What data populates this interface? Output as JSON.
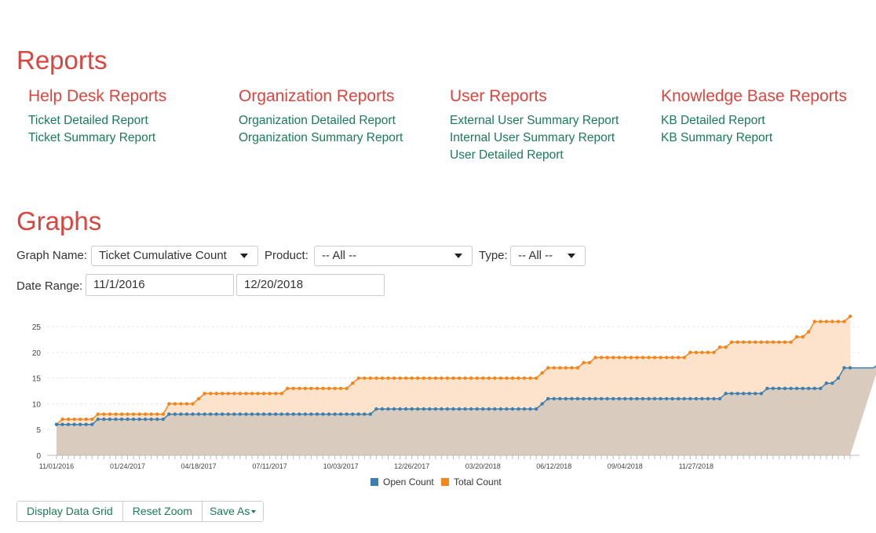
{
  "reports": {
    "title": "Reports",
    "groups": [
      {
        "title": "Help Desk Reports",
        "links": [
          "Ticket Detailed Report",
          "Ticket Summary Report"
        ]
      },
      {
        "title": "Organization Reports",
        "links": [
          "Organization Detailed Report",
          "Organization Summary Report"
        ]
      },
      {
        "title": "User Reports",
        "links": [
          "External User Summary Report",
          "Internal User Summary Report",
          "User Detailed Report"
        ]
      },
      {
        "title": "Knowledge Base Reports",
        "links": [
          "KB Detailed Report",
          "KB Summary Report"
        ]
      }
    ]
  },
  "graphs": {
    "title": "Graphs",
    "graph_name_label": "Graph Name:",
    "graph_name_value": "Ticket Cumulative Count",
    "product_label": "Product:",
    "product_value": "-- All --",
    "type_label": "Type:",
    "type_value": "-- All --",
    "date_range_label": "Date Range:",
    "date_start": "11/1/2016",
    "date_end": "12/20/2018"
  },
  "buttons": {
    "display_data_grid": "Display Data Grid",
    "reset_zoom": "Reset Zoom",
    "save_as": "Save As"
  },
  "colors": {
    "open": "#3f7faf",
    "total": "#f2861d",
    "heading": "#d9453f",
    "link": "#1b7a5a"
  },
  "chart_data": {
    "type": "area",
    "x_tick_labels": [
      "11/01/2016",
      "01/24/2017",
      "04/18/2017",
      "07/11/2017",
      "10/03/2017",
      "12/26/2017",
      "03/20/2018",
      "06/12/2018",
      "09/04/2018",
      "11/27/2018"
    ],
    "x_note": "weekly points from 11/01/2016 to 12/04/2018 (110 points)",
    "ylim": [
      0,
      27
    ],
    "y_ticks": [
      0,
      5,
      10,
      15,
      20,
      25
    ],
    "legend_position": "bottom-center",
    "series": [
      {
        "name": "Open Count",
        "color": "#3f7faf",
        "steps": [
          [
            0,
            6
          ],
          [
            1,
            6
          ],
          [
            2,
            6
          ],
          [
            3,
            6
          ],
          [
            4,
            6
          ],
          [
            5,
            6
          ],
          [
            6,
            6
          ],
          [
            7,
            7
          ],
          [
            19,
            8
          ],
          [
            54,
            9
          ],
          [
            82,
            10
          ],
          [
            83,
            11
          ],
          [
            104,
            17
          ],
          [
            109,
            18
          ]
        ],
        "values": [
          6,
          6,
          6,
          6,
          6,
          6,
          6,
          7,
          7,
          7,
          7,
          7,
          7,
          7,
          7,
          7,
          7,
          7,
          7,
          8,
          8,
          8,
          8,
          8,
          8,
          8,
          8,
          8,
          8,
          8,
          8,
          8,
          8,
          8,
          8,
          8,
          8,
          8,
          8,
          8,
          8,
          8,
          8,
          8,
          8,
          8,
          8,
          8,
          8,
          8,
          8,
          8,
          8,
          8,
          9,
          9,
          9,
          9,
          9,
          9,
          9,
          9,
          9,
          9,
          9,
          9,
          9,
          9,
          9,
          9,
          9,
          9,
          9,
          9,
          9,
          9,
          9,
          9,
          9,
          9,
          9,
          9,
          10,
          11,
          11,
          11,
          11,
          11,
          11,
          11,
          11,
          11,
          11,
          11,
          11,
          11,
          11,
          11,
          11,
          11,
          11,
          11,
          11,
          11,
          11,
          11,
          11,
          11,
          11,
          11,
          11,
          11,
          11,
          12,
          12,
          12,
          12,
          12,
          12,
          12,
          13,
          13,
          13,
          13,
          13,
          13,
          13,
          13,
          13,
          13,
          14,
          14,
          15,
          17,
          17,
          17,
          17,
          17,
          17,
          18
        ]
      },
      {
        "name": "Total Count",
        "color": "#f2861d",
        "values": [
          6,
          7,
          7,
          7,
          7,
          7,
          7,
          8,
          8,
          8,
          8,
          8,
          8,
          8,
          8,
          8,
          8,
          8,
          8,
          10,
          10,
          10,
          10,
          10,
          11,
          12,
          12,
          12,
          12,
          12,
          12,
          12,
          12,
          12,
          12,
          12,
          12,
          12,
          12,
          13,
          13,
          13,
          13,
          13,
          13,
          13,
          13,
          13,
          13,
          13,
          14,
          15,
          15,
          15,
          15,
          15,
          15,
          15,
          15,
          15,
          15,
          15,
          15,
          15,
          15,
          15,
          15,
          15,
          15,
          15,
          15,
          15,
          15,
          15,
          15,
          15,
          15,
          15,
          15,
          15,
          15,
          15,
          16,
          17,
          17,
          17,
          17,
          17,
          17,
          18,
          18,
          19,
          19,
          19,
          19,
          19,
          19,
          19,
          19,
          19,
          19,
          19,
          19,
          19,
          19,
          19,
          19,
          20,
          20,
          20,
          20,
          20,
          21,
          21,
          22,
          22,
          22,
          22,
          22,
          22,
          22,
          22,
          22,
          22,
          22,
          23,
          23,
          24,
          26,
          26,
          26,
          26,
          26,
          26,
          27
        ]
      }
    ]
  }
}
